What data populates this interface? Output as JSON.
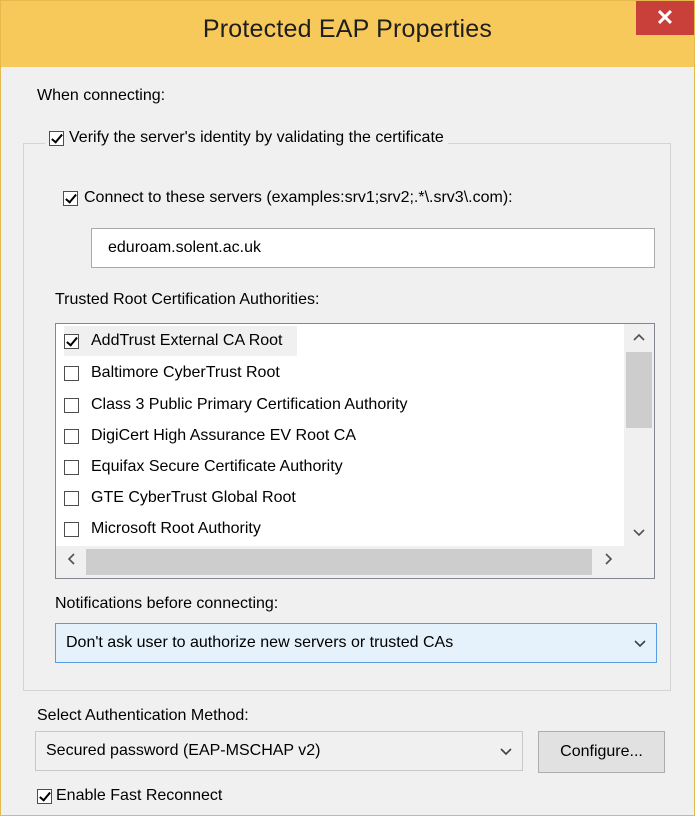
{
  "window": {
    "title": "Protected EAP Properties",
    "close_glyph": "✕"
  },
  "when_connecting_label": "When connecting:",
  "verify_server": {
    "label": "Verify the server's identity by validating the certificate",
    "checked": true
  },
  "connect_servers": {
    "label": "Connect to these servers (examples:srv1;srv2;.*\\.srv3\\.com):",
    "checked": true
  },
  "servers_value": "eduroam.solent.ac.uk",
  "trusted_root_label": "Trusted Root Certification Authorities:",
  "certificates": [
    {
      "label": "AddTrust External CA Root",
      "checked": true,
      "selected": true
    },
    {
      "label": "Baltimore CyberTrust Root",
      "checked": false
    },
    {
      "label": "Class 3 Public Primary Certification Authority",
      "checked": false
    },
    {
      "label": "DigiCert High Assurance EV Root CA",
      "checked": false
    },
    {
      "label": "Equifax Secure Certificate Authority",
      "checked": false
    },
    {
      "label": "GTE CyberTrust Global Root",
      "checked": false
    },
    {
      "label": "Microsoft Root Authority",
      "checked": false
    }
  ],
  "notifications_label": "Notifications before connecting:",
  "notifications_value": "Don't ask user to authorize new servers or trusted CAs",
  "auth_method_label": "Select Authentication Method:",
  "auth_method_value": "Secured password (EAP-MSCHAP v2)",
  "configure_label": "Configure...",
  "fast_reconnect": {
    "label": "Enable Fast Reconnect",
    "checked": true
  },
  "colors": {
    "titlebar": "#f7c95a",
    "close": "#c9403a",
    "combo_focus": "#e5f1fb"
  },
  "icons": {
    "scroll_up": "▲",
    "scroll_down": "▼",
    "scroll_left": "◀",
    "scroll_right": "▶",
    "dropdown": "chevron-down-icon"
  }
}
